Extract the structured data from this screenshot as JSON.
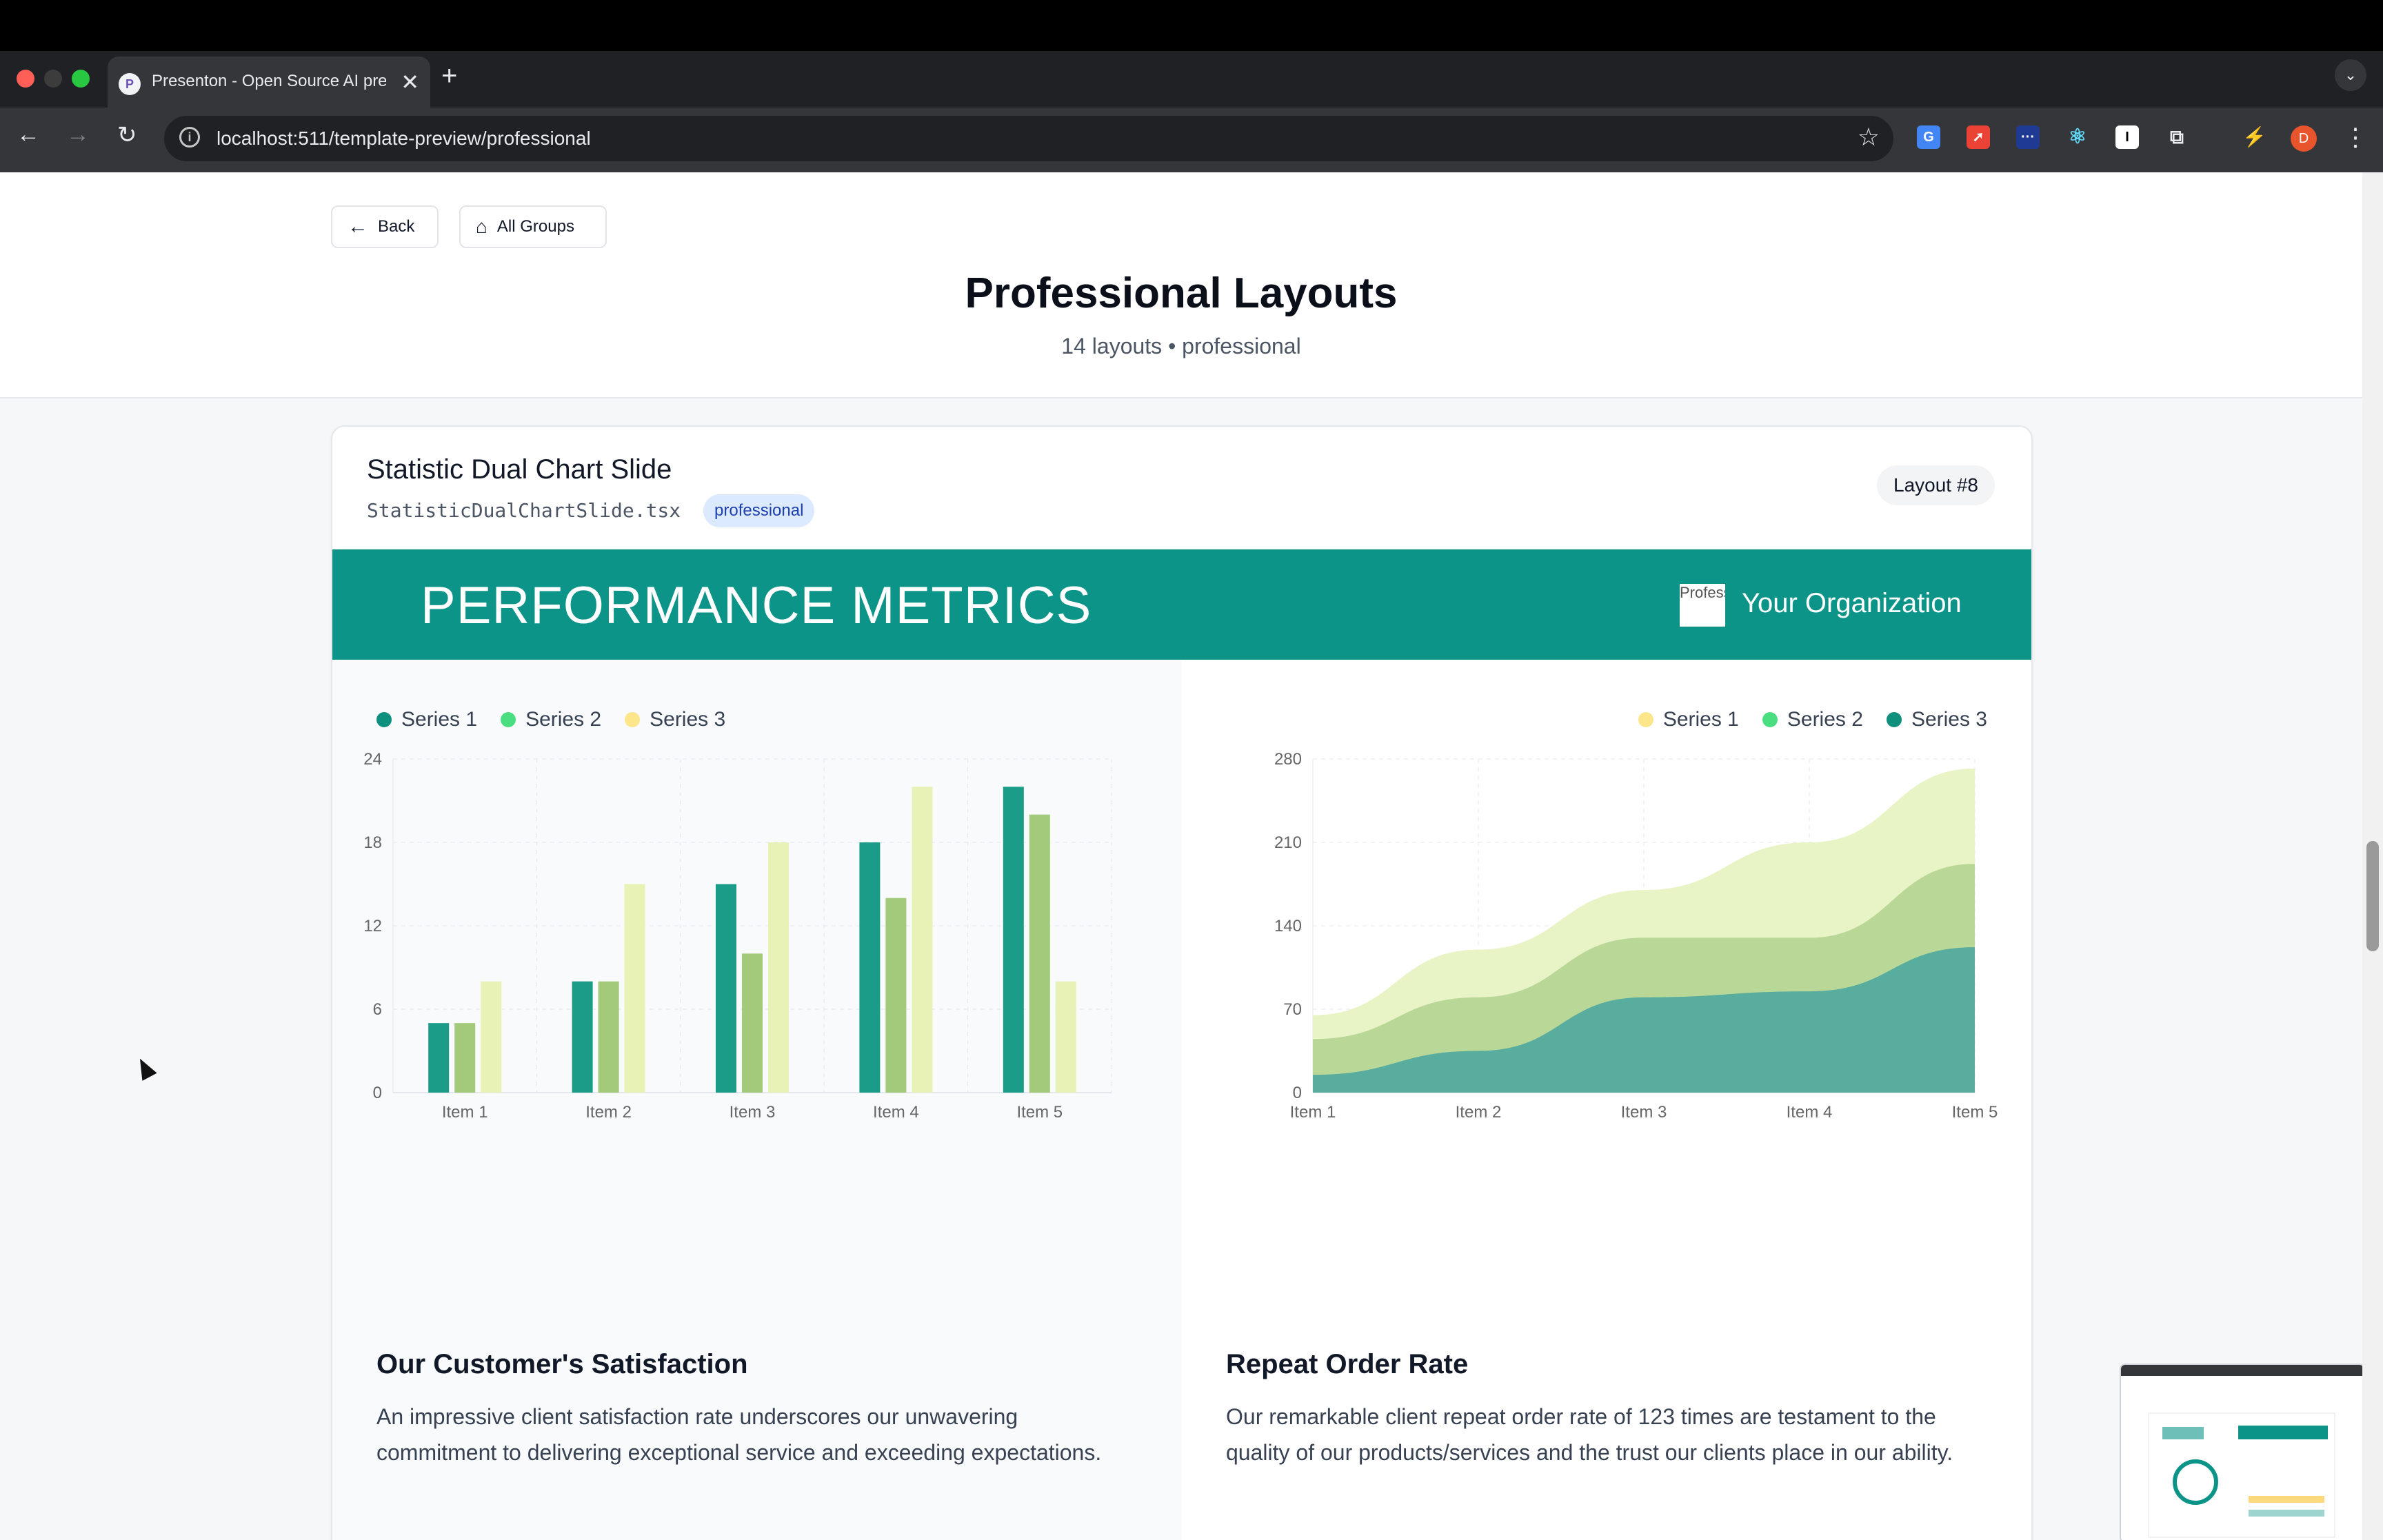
{
  "browser": {
    "tab_title": "Presenton - Open Source AI presentation generator",
    "url": "localhost:511/template-preview/professional",
    "profile_initial": "D",
    "new_tab": "+",
    "tab_close": "✕"
  },
  "toolbar": {
    "back_label": "Back",
    "all_groups_label": "All Groups"
  },
  "header": {
    "title": "Professional Layouts",
    "subtitle": "14 layouts • professional"
  },
  "card": {
    "title": "Statistic Dual Chart Slide",
    "file": "StatisticDualChartSlide.tsx",
    "tag": "professional",
    "badge": "Layout #8"
  },
  "slide": {
    "title": "PERFORMANCE METRICS",
    "org_logo_alt": "Professional logo",
    "org_name": "Your Organization",
    "left": {
      "heading": "Our Customer's Satisfaction",
      "body": "An impressive client satisfaction rate underscores our unwavering commitment to delivering exceptional service and exceeding expectations."
    },
    "right": {
      "heading": "Repeat Order Rate",
      "body": "Our remarkable client repeat order rate of 123 times are testament to the quality of our products/services and the trust our clients place in our ability."
    }
  },
  "colors": {
    "teal": "#0d9488",
    "series_bar": [
      "#1a9c88",
      "#a3c97a",
      "#e8f2b6"
    ],
    "series_area": [
      "#e9f4c6",
      "#b9d898",
      "#58ad9f"
    ],
    "legend_left": [
      "#0f8f7d",
      "#4ade80",
      "#fde68a"
    ],
    "legend_right": [
      "#fde68a",
      "#4ade80",
      "#0f8f7d"
    ]
  },
  "chart_data": [
    {
      "type": "bar",
      "categories": [
        "Item 1",
        "Item 2",
        "Item 3",
        "Item 4",
        "Item 5"
      ],
      "series": [
        {
          "name": "Series 1",
          "values": [
            5,
            8,
            15,
            18,
            22
          ]
        },
        {
          "name": "Series 2",
          "values": [
            5,
            8,
            10,
            14,
            20
          ]
        },
        {
          "name": "Series 3",
          "values": [
            8,
            15,
            18,
            22,
            8
          ]
        }
      ],
      "ylim": [
        0,
        24
      ],
      "yticks": [
        0,
        6,
        12,
        18,
        24
      ],
      "grid": true,
      "legend": "top-left"
    },
    {
      "type": "area",
      "stacked": true,
      "categories": [
        "Item 1",
        "Item 2",
        "Item 3",
        "Item 4",
        "Item 5"
      ],
      "series": [
        {
          "name": "Series 1",
          "values": [
            20,
            40,
            40,
            80,
            80
          ]
        },
        {
          "name": "Series 2",
          "values": [
            30,
            45,
            50,
            45,
            70
          ]
        },
        {
          "name": "Series 3",
          "values": [
            15,
            35,
            80,
            85,
            122
          ]
        }
      ],
      "ylim": [
        0,
        280
      ],
      "yticks": [
        0,
        70,
        140,
        210,
        280
      ],
      "grid": true,
      "legend": "top-right"
    }
  ]
}
